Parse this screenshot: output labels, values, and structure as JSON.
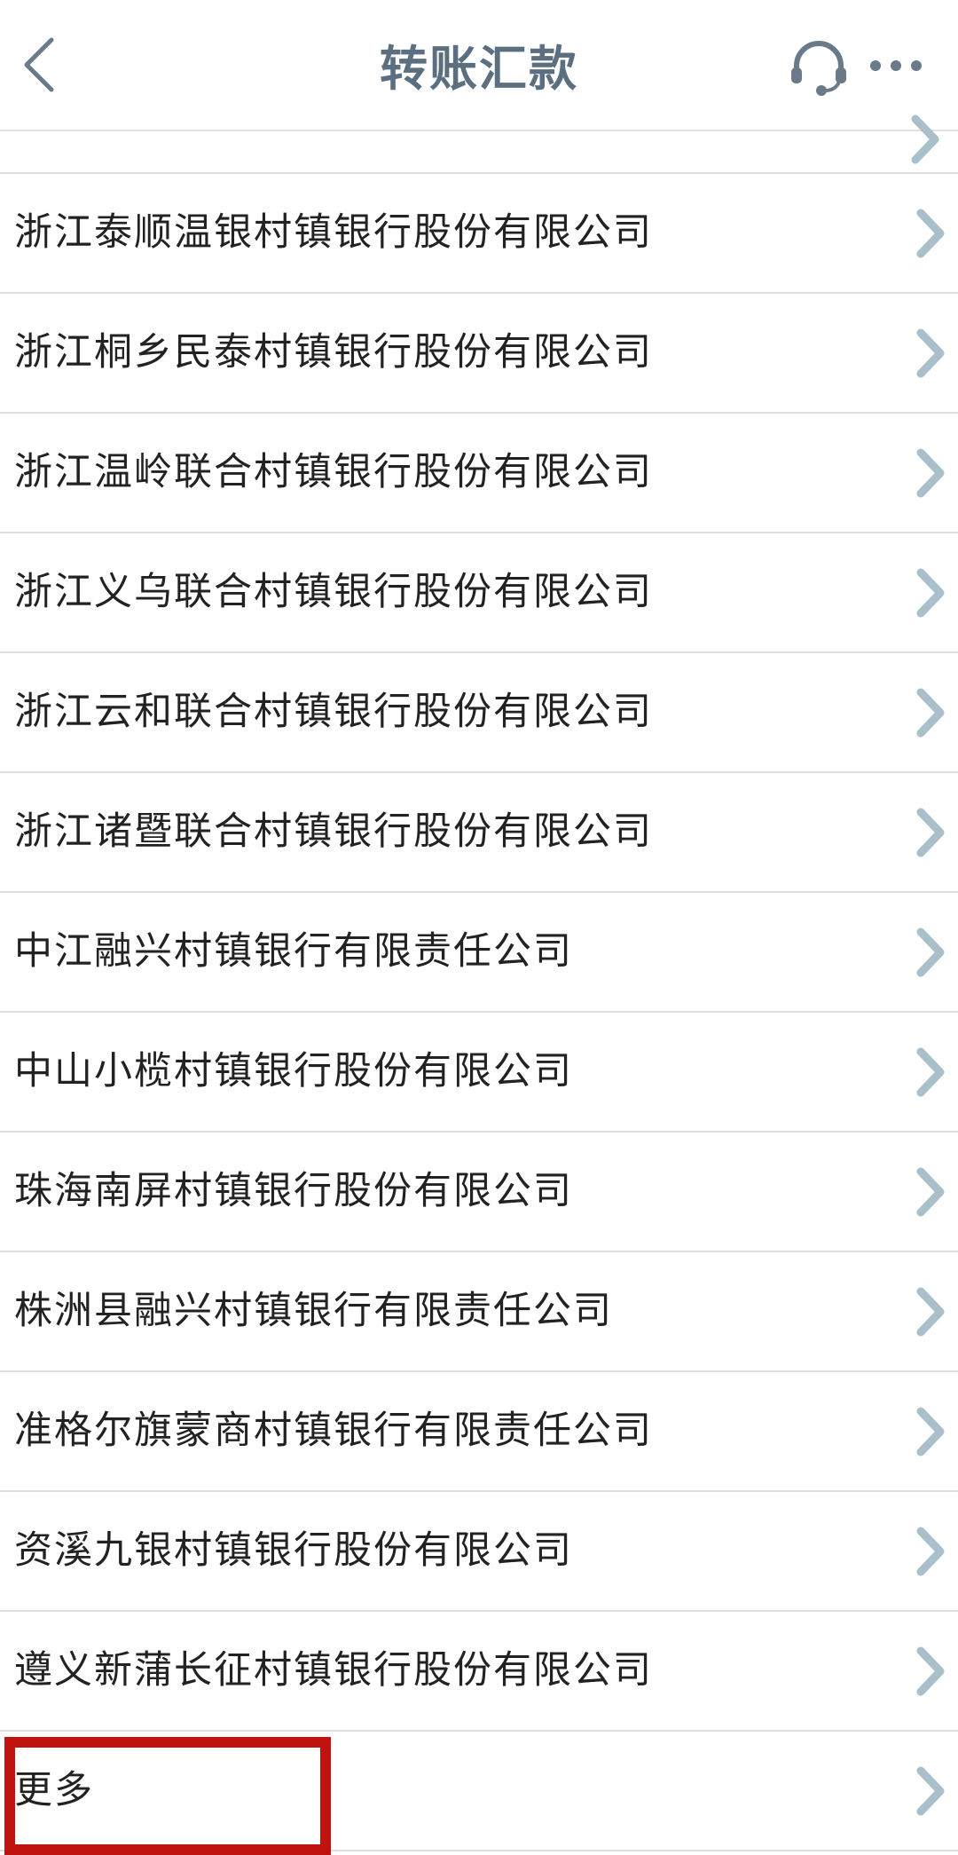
{
  "header": {
    "title": "转账汇款",
    "back_icon": "chevron-left-icon",
    "service_icon": "headset-icon",
    "more_icon": "ellipsis-icon",
    "title_color": "#5c6f80"
  },
  "banks": [
    {
      "label": "浙江泰顺温银村镇银行股份有限公司"
    },
    {
      "label": "浙江桐乡民泰村镇银行股份有限公司"
    },
    {
      "label": "浙江温岭联合村镇银行股份有限公司"
    },
    {
      "label": "浙江义乌联合村镇银行股份有限公司"
    },
    {
      "label": "浙江云和联合村镇银行股份有限公司"
    },
    {
      "label": "浙江诸暨联合村镇银行股份有限公司"
    },
    {
      "label": "中江融兴村镇银行有限责任公司"
    },
    {
      "label": "中山小榄村镇银行股份有限公司"
    },
    {
      "label": "珠海南屏村镇银行股份有限公司"
    },
    {
      "label": "株洲县融兴村镇银行有限责任公司"
    },
    {
      "label": "准格尔旗蒙商村镇银行有限责任公司"
    },
    {
      "label": "资溪九银村镇银行股份有限公司"
    },
    {
      "label": "遵义新蒲长征村镇银行股份有限公司"
    },
    {
      "label": "更多"
    }
  ],
  "colors": {
    "chevron": "#a9bfca",
    "highlight": "#c0130f",
    "divider": "#dedede"
  }
}
